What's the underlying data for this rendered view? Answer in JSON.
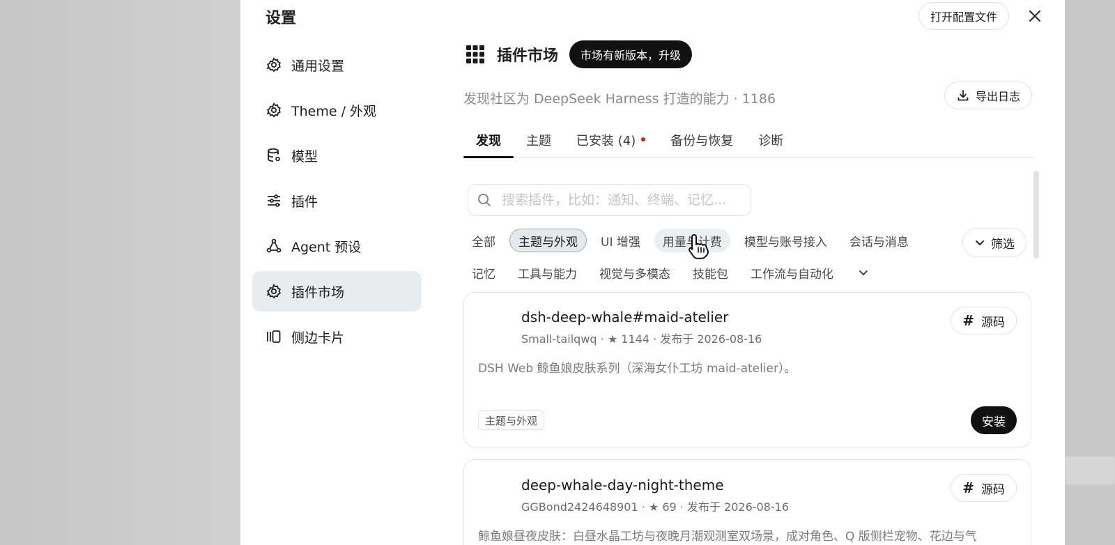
{
  "dialog": {
    "title": "设置",
    "open_config_label": "打开配置文件"
  },
  "sidebar": {
    "items": [
      {
        "label": "通用设置",
        "icon": "gear-icon"
      },
      {
        "label": "Theme / 外观",
        "icon": "gear-icon"
      },
      {
        "label": "模型",
        "icon": "database-icon"
      },
      {
        "label": "插件",
        "icon": "sliders-icon"
      },
      {
        "label": "Agent 预设",
        "icon": "agent-nodes-icon"
      },
      {
        "label": "插件市场",
        "icon": "gear-icon",
        "active": true
      },
      {
        "label": "侧边卡片",
        "icon": "side-cards-icon"
      }
    ]
  },
  "market": {
    "title": "插件市场",
    "upgrade_label": "市场有新版本，升级",
    "subtitle": "发现社区为 DeepSeek Harness 打造的能力 · 1186",
    "export_label": "导出日志",
    "tabs": [
      {
        "label": "发现",
        "active": true
      },
      {
        "label": "主题"
      },
      {
        "label": "已安装 (4)",
        "dot": true
      },
      {
        "label": "备份与恢复"
      },
      {
        "label": "诊断"
      }
    ],
    "search_placeholder": "搜索插件，比如：通知、终端、记忆...",
    "filter_label": "筛选",
    "categories_row1": [
      "全部",
      "主题与外观",
      "UI 增强",
      "用量与计费",
      "模型与账号接入",
      "会话与消息"
    ],
    "categories_row2": [
      "记忆",
      "工具与能力",
      "视觉与多模态",
      "技能包",
      "工作流与自动化"
    ],
    "selected_category": "主题与外观",
    "plugins": [
      {
        "name": "dsh-deep-whale#maid-atelier",
        "meta": "Small-tailqwq · ★ 1144 · 发布于 2026-08-16",
        "description": "DSH Web 鲸鱼娘皮肤系列（深海女仆工坊 maid-atelier）。",
        "tag": "主题与外观",
        "source_label": "源码",
        "install_label": "安装"
      },
      {
        "name": "deep-whale-day-night-theme",
        "meta": "GGBond2424648901 · ★ 69 · 发布于 2026-08-16",
        "description": "鲸鱼娘昼夜皮肤：白昼水晶工坊与夜晚月潮观测室双场景，成对角色、Q 版侧栏宠物、花边与气",
        "source_label": "源码"
      }
    ]
  },
  "colors": {
    "accent": "#111111",
    "sidebar_active_bg": "#e9ecee",
    "selected_chip_bg": "#e5e9ed",
    "notification_dot": "#d32222"
  }
}
